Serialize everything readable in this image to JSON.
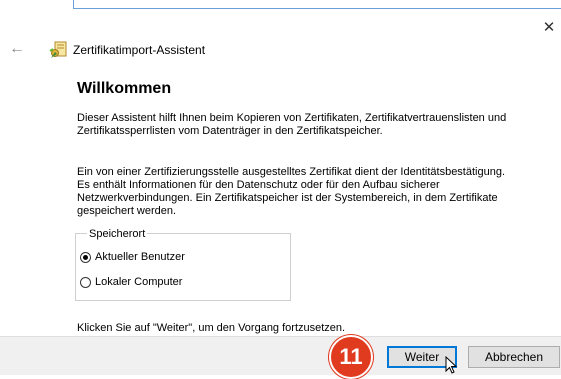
{
  "window": {
    "title": "Zertifikatimport-Assistent",
    "close_glyph": "✕",
    "back_glyph": "←"
  },
  "main": {
    "heading": "Willkommen",
    "paragraph1": "Dieser Assistent hilft Ihnen beim Kopieren von Zertifikaten, Zertifikatvertrauenslisten und\nZertifikatssperrlisten vom Datenträger in den Zertifikatspeicher.",
    "paragraph2": "Ein von einer Zertifizierungsstelle ausgestelltes Zertifikat dient der Identitätsbestätigung.\nEs enthält Informationen für den Datenschutz oder für den Aufbau sicherer\nNetzwerkverbindungen. Ein Zertifikatspeicher ist der Systembereich, in dem Zertifikate\ngespeichert werden.",
    "storage": {
      "legend": "Speicherort",
      "options": [
        {
          "label": "Aktueller Benutzer",
          "selected": true
        },
        {
          "label": "Lokaler Computer",
          "selected": false
        }
      ]
    },
    "hint": "Klicken Sie auf \"Weiter\", um den Vorgang fortzusetzen."
  },
  "footer": {
    "next_label": "Weiter",
    "cancel_label": "Abbrechen"
  },
  "annotation": {
    "step_number": "11",
    "color": "#e03a1f"
  },
  "icons": {
    "back": "back-arrow-icon",
    "wizard": "certificate-wizard-icon",
    "close": "close-icon",
    "cursor": "mouse-pointer-icon"
  },
  "colors": {
    "accent": "#0078d7",
    "footer_bg": "#f0f0f0",
    "button_bg": "#e1e1e1"
  }
}
